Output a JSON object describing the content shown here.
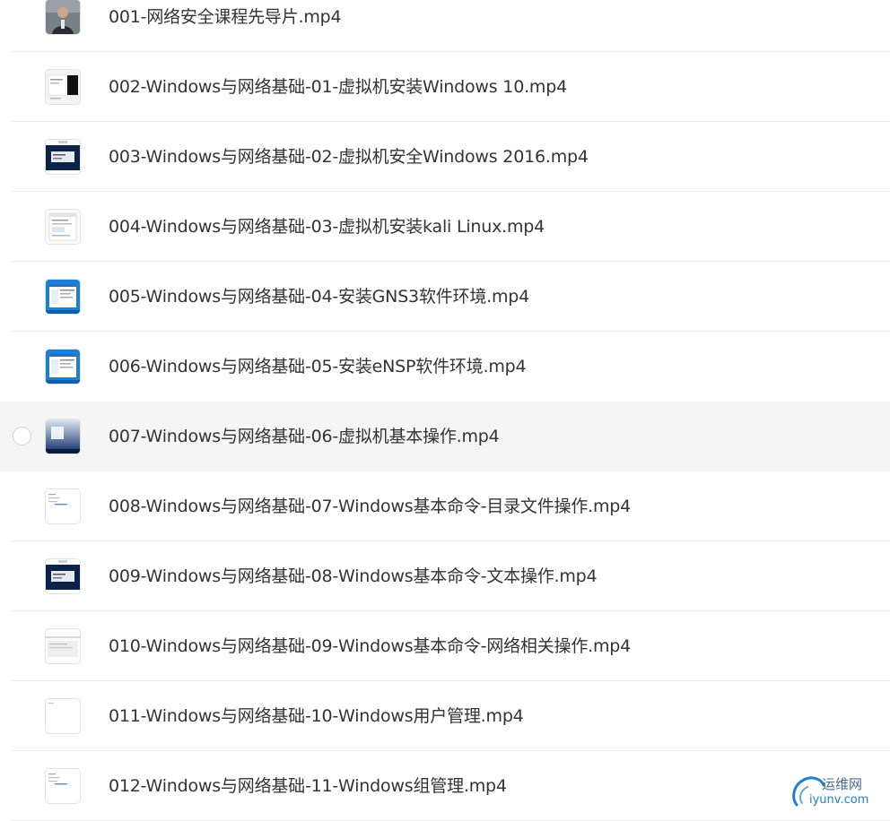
{
  "files": [
    {
      "name": "001-网络安全课程先导片.mp4",
      "thumb": "person-thumbnail-icon",
      "selected": false
    },
    {
      "name": "002-Windows与网络基础-01-虚拟机安装Windows 10.mp4",
      "thumb": "installer-dark-thumbnail-icon",
      "selected": false
    },
    {
      "name": "003-Windows与网络基础-02-虚拟机安全Windows 2016.mp4",
      "thumb": "navy-screen-thumbnail-icon",
      "selected": false
    },
    {
      "name": "004-Windows与网络基础-03-虚拟机安装kali Linux.mp4",
      "thumb": "dialog-thumbnail-icon",
      "selected": false
    },
    {
      "name": "005-Windows与网络基础-04-安装GNS3软件环境.mp4",
      "thumb": "blue-window-thumbnail-icon",
      "selected": false
    },
    {
      "name": "006-Windows与网络基础-05-安装eNSP软件环境.mp4",
      "thumb": "blue-window-thumbnail-icon",
      "selected": false
    },
    {
      "name": "007-Windows与网络基础-06-虚拟机基本操作.mp4",
      "thumb": "desktop-thumbnail-icon",
      "selected": true
    },
    {
      "name": "008-Windows与网络基础-07-Windows基本命令-目录文件操作.mp4",
      "thumb": "text-page-thumbnail-icon",
      "selected": false
    },
    {
      "name": "009-Windows与网络基础-08-Windows基本命令-文本操作.mp4",
      "thumb": "navy-screen-thumbnail-icon",
      "selected": false
    },
    {
      "name": "010-Windows与网络基础-09-Windows基本命令-网络相关操作.mp4",
      "thumb": "grey-page-thumbnail-icon",
      "selected": false
    },
    {
      "name": "011-Windows与网络基础-10-Windows用户管理.mp4",
      "thumb": "blank-page-thumbnail-icon",
      "selected": false
    },
    {
      "name": "012-Windows与网络基础-11-Windows组管理.mp4",
      "thumb": "text-page-thumbnail-icon",
      "selected": false
    }
  ],
  "watermark": {
    "brand_cn": "运维网",
    "brand_en": "iyunv.com",
    "icon": "iyunv-logo-icon"
  },
  "colors": {
    "text": "#333333",
    "selected_row": "#f5f5f5",
    "divider": "#ececec",
    "watermark_blue": "#1f7fd1"
  }
}
